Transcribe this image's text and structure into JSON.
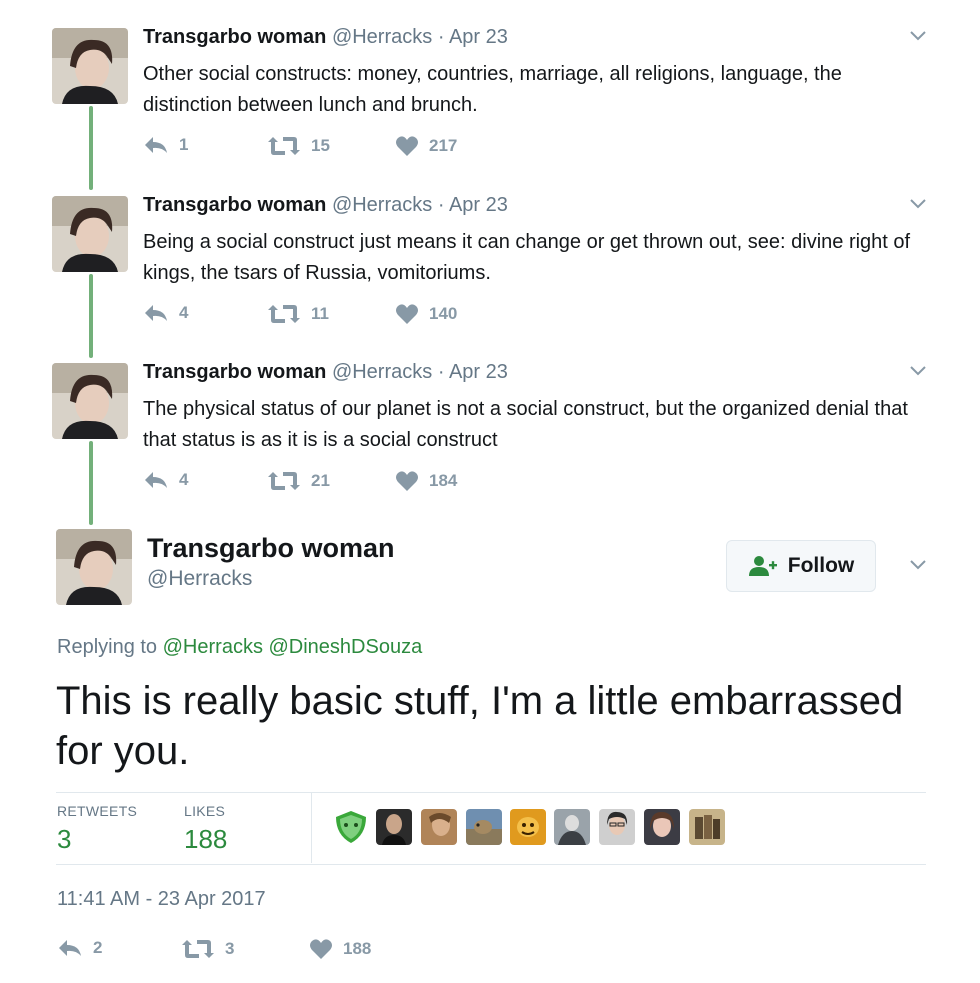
{
  "colors": {
    "accent": "#2c8a3e",
    "thread_line": "#73b07a",
    "muted": "#657786",
    "icon": "#8899a6"
  },
  "thread": [
    {
      "name": "Transgarbo woman",
      "handle": "@Herracks",
      "dot": "·",
      "date": "Apr 23",
      "text": "Other social constructs: money, countries, marriage, all religions, language, the distinction between lunch and brunch.",
      "replies": "1",
      "retweets": "15",
      "likes": "217"
    },
    {
      "name": "Transgarbo woman",
      "handle": "@Herracks",
      "dot": "·",
      "date": "Apr 23",
      "text": "Being a social construct just means it can change or get thrown out, see: divine right of kings, the tsars of Russia, vomitoriums.",
      "replies": "4",
      "retweets": "11",
      "likes": "140"
    },
    {
      "name": "Transgarbo woman",
      "handle": "@Herracks",
      "dot": "·",
      "date": "Apr 23",
      "text": "The physical status of our planet is not a social construct, but the organized denial that that status is as it is is a social construct",
      "replies": "4",
      "retweets": "21",
      "likes": "184"
    }
  ],
  "focus": {
    "name": "Transgarbo woman",
    "handle": "@Herracks",
    "follow_label": "Follow",
    "replying_prefix": "Replying to",
    "replying_mentions": "@Herracks @DineshDSouza",
    "text": "This is really basic stuff, I'm a little embarrassed for you.",
    "stats": {
      "retweets_label": "RETWEETS",
      "retweets_value": "3",
      "likes_label": "LIKES",
      "likes_value": "188"
    },
    "timestamp": "11:41 AM - 23 Apr 2017",
    "actions": {
      "replies": "2",
      "retweets": "3",
      "likes": "188"
    }
  },
  "icons": {
    "reply": "reply-icon",
    "retweet": "retweet-icon",
    "like": "heart-icon",
    "caret": "chevron-down-icon",
    "follow": "add-user-icon"
  }
}
